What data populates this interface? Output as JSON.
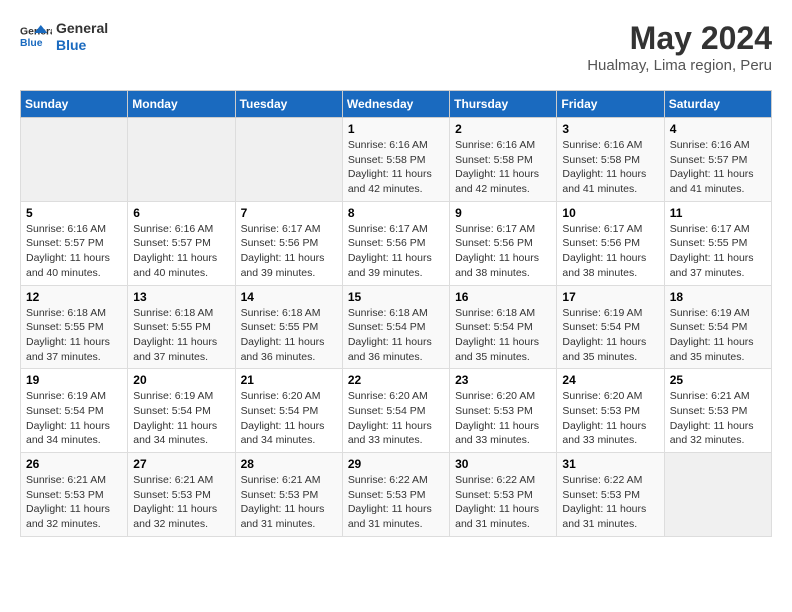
{
  "logo": {
    "line1": "General",
    "line2": "Blue"
  },
  "title": "May 2024",
  "location": "Hualmay, Lima region, Peru",
  "days_header": [
    "Sunday",
    "Monday",
    "Tuesday",
    "Wednesday",
    "Thursday",
    "Friday",
    "Saturday"
  ],
  "weeks": [
    [
      {
        "day": "",
        "info": ""
      },
      {
        "day": "",
        "info": ""
      },
      {
        "day": "",
        "info": ""
      },
      {
        "day": "1",
        "info": "Sunrise: 6:16 AM\nSunset: 5:58 PM\nDaylight: 11 hours\nand 42 minutes."
      },
      {
        "day": "2",
        "info": "Sunrise: 6:16 AM\nSunset: 5:58 PM\nDaylight: 11 hours\nand 42 minutes."
      },
      {
        "day": "3",
        "info": "Sunrise: 6:16 AM\nSunset: 5:58 PM\nDaylight: 11 hours\nand 41 minutes."
      },
      {
        "day": "4",
        "info": "Sunrise: 6:16 AM\nSunset: 5:57 PM\nDaylight: 11 hours\nand 41 minutes."
      }
    ],
    [
      {
        "day": "5",
        "info": "Sunrise: 6:16 AM\nSunset: 5:57 PM\nDaylight: 11 hours\nand 40 minutes."
      },
      {
        "day": "6",
        "info": "Sunrise: 6:16 AM\nSunset: 5:57 PM\nDaylight: 11 hours\nand 40 minutes."
      },
      {
        "day": "7",
        "info": "Sunrise: 6:17 AM\nSunset: 5:56 PM\nDaylight: 11 hours\nand 39 minutes."
      },
      {
        "day": "8",
        "info": "Sunrise: 6:17 AM\nSunset: 5:56 PM\nDaylight: 11 hours\nand 39 minutes."
      },
      {
        "day": "9",
        "info": "Sunrise: 6:17 AM\nSunset: 5:56 PM\nDaylight: 11 hours\nand 38 minutes."
      },
      {
        "day": "10",
        "info": "Sunrise: 6:17 AM\nSunset: 5:56 PM\nDaylight: 11 hours\nand 38 minutes."
      },
      {
        "day": "11",
        "info": "Sunrise: 6:17 AM\nSunset: 5:55 PM\nDaylight: 11 hours\nand 37 minutes."
      }
    ],
    [
      {
        "day": "12",
        "info": "Sunrise: 6:18 AM\nSunset: 5:55 PM\nDaylight: 11 hours\nand 37 minutes."
      },
      {
        "day": "13",
        "info": "Sunrise: 6:18 AM\nSunset: 5:55 PM\nDaylight: 11 hours\nand 37 minutes."
      },
      {
        "day": "14",
        "info": "Sunrise: 6:18 AM\nSunset: 5:55 PM\nDaylight: 11 hours\nand 36 minutes."
      },
      {
        "day": "15",
        "info": "Sunrise: 6:18 AM\nSunset: 5:54 PM\nDaylight: 11 hours\nand 36 minutes."
      },
      {
        "day": "16",
        "info": "Sunrise: 6:18 AM\nSunset: 5:54 PM\nDaylight: 11 hours\nand 35 minutes."
      },
      {
        "day": "17",
        "info": "Sunrise: 6:19 AM\nSunset: 5:54 PM\nDaylight: 11 hours\nand 35 minutes."
      },
      {
        "day": "18",
        "info": "Sunrise: 6:19 AM\nSunset: 5:54 PM\nDaylight: 11 hours\nand 35 minutes."
      }
    ],
    [
      {
        "day": "19",
        "info": "Sunrise: 6:19 AM\nSunset: 5:54 PM\nDaylight: 11 hours\nand 34 minutes."
      },
      {
        "day": "20",
        "info": "Sunrise: 6:19 AM\nSunset: 5:54 PM\nDaylight: 11 hours\nand 34 minutes."
      },
      {
        "day": "21",
        "info": "Sunrise: 6:20 AM\nSunset: 5:54 PM\nDaylight: 11 hours\nand 34 minutes."
      },
      {
        "day": "22",
        "info": "Sunrise: 6:20 AM\nSunset: 5:54 PM\nDaylight: 11 hours\nand 33 minutes."
      },
      {
        "day": "23",
        "info": "Sunrise: 6:20 AM\nSunset: 5:53 PM\nDaylight: 11 hours\nand 33 minutes."
      },
      {
        "day": "24",
        "info": "Sunrise: 6:20 AM\nSunset: 5:53 PM\nDaylight: 11 hours\nand 33 minutes."
      },
      {
        "day": "25",
        "info": "Sunrise: 6:21 AM\nSunset: 5:53 PM\nDaylight: 11 hours\nand 32 minutes."
      }
    ],
    [
      {
        "day": "26",
        "info": "Sunrise: 6:21 AM\nSunset: 5:53 PM\nDaylight: 11 hours\nand 32 minutes."
      },
      {
        "day": "27",
        "info": "Sunrise: 6:21 AM\nSunset: 5:53 PM\nDaylight: 11 hours\nand 32 minutes."
      },
      {
        "day": "28",
        "info": "Sunrise: 6:21 AM\nSunset: 5:53 PM\nDaylight: 11 hours\nand 31 minutes."
      },
      {
        "day": "29",
        "info": "Sunrise: 6:22 AM\nSunset: 5:53 PM\nDaylight: 11 hours\nand 31 minutes."
      },
      {
        "day": "30",
        "info": "Sunrise: 6:22 AM\nSunset: 5:53 PM\nDaylight: 11 hours\nand 31 minutes."
      },
      {
        "day": "31",
        "info": "Sunrise: 6:22 AM\nSunset: 5:53 PM\nDaylight: 11 hours\nand 31 minutes."
      },
      {
        "day": "",
        "info": ""
      }
    ]
  ]
}
